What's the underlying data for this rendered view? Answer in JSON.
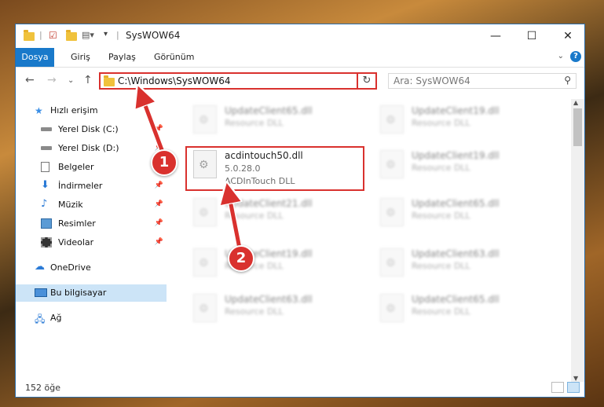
{
  "window": {
    "title": "SysWOW64",
    "controls": {
      "minimize": "—",
      "maximize": "☐",
      "close": "✕"
    }
  },
  "ribbon": {
    "tabs": [
      "Dosya",
      "Giriş",
      "Paylaş",
      "Görünüm"
    ],
    "help_label": "?"
  },
  "navbar": {
    "address": "C:\\Windows\\SysWOW64",
    "search_placeholder": "Ara: SysWOW64"
  },
  "nav_pane": {
    "items": [
      {
        "label": "Hızlı erişim",
        "icon": "star-icon"
      },
      {
        "label": "Yerel Disk (C:)",
        "icon": "drive-icon"
      },
      {
        "label": "Yerel Disk (D:)",
        "icon": "drive-icon"
      },
      {
        "label": "Belgeler",
        "icon": "documents-icon"
      },
      {
        "label": "İndirmeler",
        "icon": "downloads-icon"
      },
      {
        "label": "Müzik",
        "icon": "music-icon"
      },
      {
        "label": "Resimler",
        "icon": "pictures-icon"
      },
      {
        "label": "Videolar",
        "icon": "videos-icon"
      },
      {
        "label": "OneDrive",
        "icon": "cloud-icon"
      },
      {
        "label": "Bu bilgisayar",
        "icon": "computer-icon"
      },
      {
        "label": "Ağ",
        "icon": "network-icon"
      }
    ]
  },
  "files": {
    "highlighted": {
      "name": "acdintouch50.dll",
      "version": "5.0.28.0",
      "description": "ACDInTouch DLL"
    },
    "others": [
      {
        "name": "UpdateClient65.dll",
        "type": "Resource DLL"
      },
      {
        "name": "UpdateClient19.dll",
        "type": "Resource DLL"
      },
      {
        "name": "UpdateClient19.dll",
        "type": "Resource DLL"
      },
      {
        "name": "UpdateClient21.dll",
        "type": "Resource DLL"
      },
      {
        "name": "UpdateClient65.dll",
        "type": "Resource DLL"
      },
      {
        "name": "UpdateClient19.dll",
        "type": "Resource DLL"
      },
      {
        "name": "UpdateClient63.dll",
        "type": "Resource DLL"
      },
      {
        "name": "UpdateClient63.dll",
        "type": "Resource DLL"
      },
      {
        "name": "UpdateClient65.dll",
        "type": "Resource DLL"
      }
    ]
  },
  "status": {
    "item_count": "152 öğe"
  },
  "annotations": {
    "step1": "1",
    "step2": "2",
    "color": "#d9312e"
  }
}
